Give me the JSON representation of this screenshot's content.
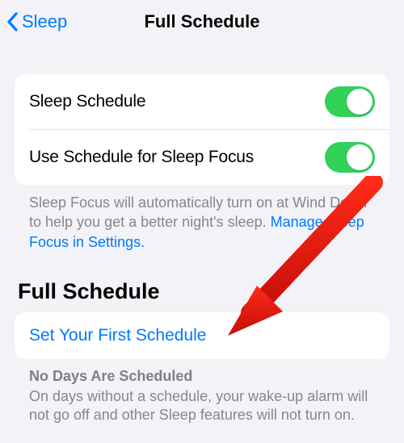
{
  "nav": {
    "back_label": "Sleep",
    "title": "Full Schedule"
  },
  "group1": {
    "rows": [
      {
        "label": "Sleep Schedule",
        "on": true
      },
      {
        "label": "Use Schedule for Sleep Focus",
        "on": true
      }
    ],
    "footer": "Sleep Focus will automatically turn on at Wind Down to help you get a better night's sleep. ",
    "footer_link": "Manage Sleep Focus in Settings."
  },
  "section_header": "Full Schedule",
  "action_label": "Set Your First Schedule",
  "empty": {
    "title": "No Days Are Scheduled",
    "body": "On days without a schedule, your wake-up alarm will not go off and other Sleep features will not turn on."
  },
  "colors": {
    "accent": "#007aff",
    "toggle_on": "#32d159",
    "bg": "#f2f2f7"
  }
}
